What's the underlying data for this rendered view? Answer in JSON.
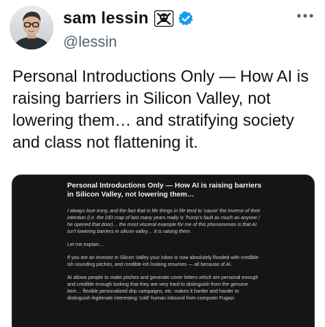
{
  "author": {
    "display_name": "sam lessin",
    "handle": "@lessin",
    "emoji": "skull-and-crossbones",
    "verified": true,
    "verified_color": "#1d9bf0"
  },
  "tweet": {
    "text": "Personal Introductions Only — How AI is raising barriers in Silicon Valley, not lowering them… and stratifying society and class not flattening it."
  },
  "media": {
    "title": "Personal Introductions Only — How AI is raising barriers in Silicon Valley, not lowering them…",
    "paragraphs": [
      "I always love irony, and the fact that in life things in life tend to ‘cause’ the inverse of their intention (i.e. the DEI crap of last many years really is Trump’s fault as much as anyone / he opened that door)… the most visceral example for me of this phenomenon is that AI isn’t lowering barriers in silicon valley… it is raising them.",
      "Let me explain…",
      "If you are an investor in Silicon Valley your inbox is now absolutely flooded with credible-ish sounding pitches, and credible-ish looking resumes — all because of AI.",
      "AI allows people to make pitches and generate cover letters which are personal enough and credible enough looking that they are very hard to distinguish from the genuine item… flexible personalized drip campaigns, etc. makes it harder and harder to distinguish legitimate interesting ‘cold’ human inbound from computer Fugazi."
    ]
  }
}
